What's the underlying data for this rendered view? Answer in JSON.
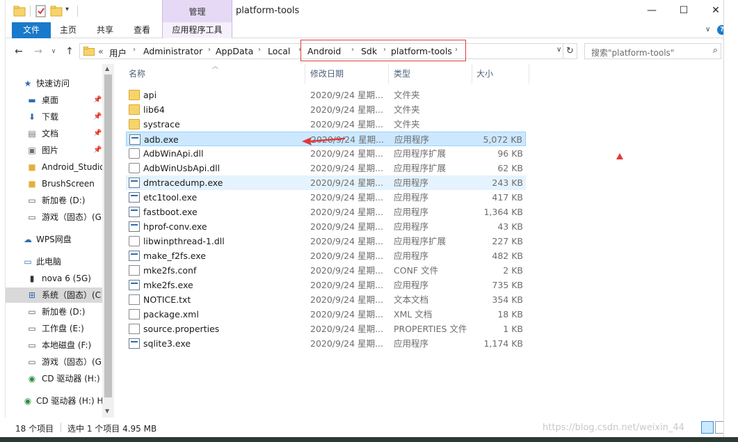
{
  "window": {
    "title": "platform-tools",
    "context_tab_group": "管理",
    "minimize": "—",
    "maximize": "☐",
    "close": "✕"
  },
  "ribbon": {
    "tabs": [
      "文件",
      "主页",
      "共享",
      "查看",
      "应用程序工具"
    ]
  },
  "address": {
    "prefix": "«",
    "path": [
      "用户",
      "Administrator",
      "AppData",
      "Local",
      "Android",
      "Sdk",
      "platform-tools"
    ],
    "search_placeholder": "搜索\"platform-tools\""
  },
  "nav": {
    "quick_access": "快速访问",
    "items": [
      {
        "label": "快速访问",
        "icon": "star-icon"
      },
      {
        "label": "桌面",
        "icon": "desktop-icon",
        "pinned": true
      },
      {
        "label": "下载",
        "icon": "download-icon",
        "pinned": true
      },
      {
        "label": "文档",
        "icon": "document-icon",
        "pinned": true
      },
      {
        "label": "图片",
        "icon": "picture-icon",
        "pinned": true
      },
      {
        "label": "Android_Studio",
        "icon": "folder-icon"
      },
      {
        "label": "BrushScreen",
        "icon": "folder-icon"
      },
      {
        "label": "新加卷 (D:)",
        "icon": "drive-icon"
      },
      {
        "label": "游戏（固态）(G",
        "icon": "drive-icon"
      },
      {
        "label": "WPS网盘",
        "icon": "cloud-icon"
      },
      {
        "label": "此电脑",
        "icon": "computer-icon"
      },
      {
        "label": "nova 6 (5G)",
        "icon": "phone-icon"
      },
      {
        "label": "系统（固态）(C",
        "icon": "windows-drive-icon"
      },
      {
        "label": "新加卷 (D:)",
        "icon": "drive-icon"
      },
      {
        "label": "工作盘 (E:)",
        "icon": "drive-icon"
      },
      {
        "label": "本地磁盘 (F:)",
        "icon": "drive-icon"
      },
      {
        "label": "游戏（固态）(G",
        "icon": "drive-icon"
      },
      {
        "label": "CD 驱动器 (H:)",
        "icon": "cd-drive-icon"
      },
      {
        "label": "CD 驱动器 (H:) H",
        "icon": "cd-drive-icon"
      }
    ]
  },
  "columns": [
    "名称",
    "修改日期",
    "类型",
    "大小"
  ],
  "files": [
    {
      "name": "api",
      "date": "2020/9/24 星期...",
      "type": "文件夹",
      "size": "",
      "icon": "folder-icon"
    },
    {
      "name": "lib64",
      "date": "2020/9/24 星期...",
      "type": "文件夹",
      "size": "",
      "icon": "folder-icon"
    },
    {
      "name": "systrace",
      "date": "2020/9/24 星期...",
      "type": "文件夹",
      "size": "",
      "icon": "folder-icon"
    },
    {
      "name": "adb.exe",
      "date": "2020/9/24 星期...",
      "type": "应用程序",
      "size": "5,072 KB",
      "icon": "exe-icon"
    },
    {
      "name": "AdbWinApi.dll",
      "date": "2020/9/24 星期...",
      "type": "应用程序扩展",
      "size": "96 KB",
      "icon": "dll-icon"
    },
    {
      "name": "AdbWinUsbApi.dll",
      "date": "2020/9/24 星期...",
      "type": "应用程序扩展",
      "size": "62 KB",
      "icon": "dll-icon"
    },
    {
      "name": "dmtracedump.exe",
      "date": "2020/9/24 星期...",
      "type": "应用程序",
      "size": "243 KB",
      "icon": "exe-icon"
    },
    {
      "name": "etc1tool.exe",
      "date": "2020/9/24 星期...",
      "type": "应用程序",
      "size": "417 KB",
      "icon": "exe-icon"
    },
    {
      "name": "fastboot.exe",
      "date": "2020/9/24 星期...",
      "type": "应用程序",
      "size": "1,364 KB",
      "icon": "exe-icon"
    },
    {
      "name": "hprof-conv.exe",
      "date": "2020/9/24 星期...",
      "type": "应用程序",
      "size": "43 KB",
      "icon": "exe-icon"
    },
    {
      "name": "libwinpthread-1.dll",
      "date": "2020/9/24 星期...",
      "type": "应用程序扩展",
      "size": "227 KB",
      "icon": "dll-icon"
    },
    {
      "name": "make_f2fs.exe",
      "date": "2020/9/24 星期...",
      "type": "应用程序",
      "size": "482 KB",
      "icon": "exe-icon"
    },
    {
      "name": "mke2fs.conf",
      "date": "2020/9/24 星期...",
      "type": "CONF 文件",
      "size": "2 KB",
      "icon": "file-icon"
    },
    {
      "name": "mke2fs.exe",
      "date": "2020/9/24 星期...",
      "type": "应用程序",
      "size": "735 KB",
      "icon": "exe-icon"
    },
    {
      "name": "NOTICE.txt",
      "date": "2020/9/24 星期...",
      "type": "文本文档",
      "size": "354 KB",
      "icon": "text-file-icon"
    },
    {
      "name": "package.xml",
      "date": "2020/9/24 星期...",
      "type": "XML 文档",
      "size": "18 KB",
      "icon": "xml-file-icon"
    },
    {
      "name": "source.properties",
      "date": "2020/9/24 星期...",
      "type": "PROPERTIES 文件",
      "size": "1 KB",
      "icon": "file-icon"
    },
    {
      "name": "sqlite3.exe",
      "date": "2020/9/24 星期...",
      "type": "应用程序",
      "size": "1,174 KB",
      "icon": "exe-icon"
    }
  ],
  "status": {
    "count": "18 个项目",
    "selection": "选中 1 个项目  4.95 MB"
  },
  "watermark": "https://blog.csdn.net/weixin_44",
  "colors": {
    "accent": "#1979ca",
    "selection": "#cce8ff",
    "highlight_box": "#e0393e",
    "context_tab": "#e6d9f5"
  }
}
